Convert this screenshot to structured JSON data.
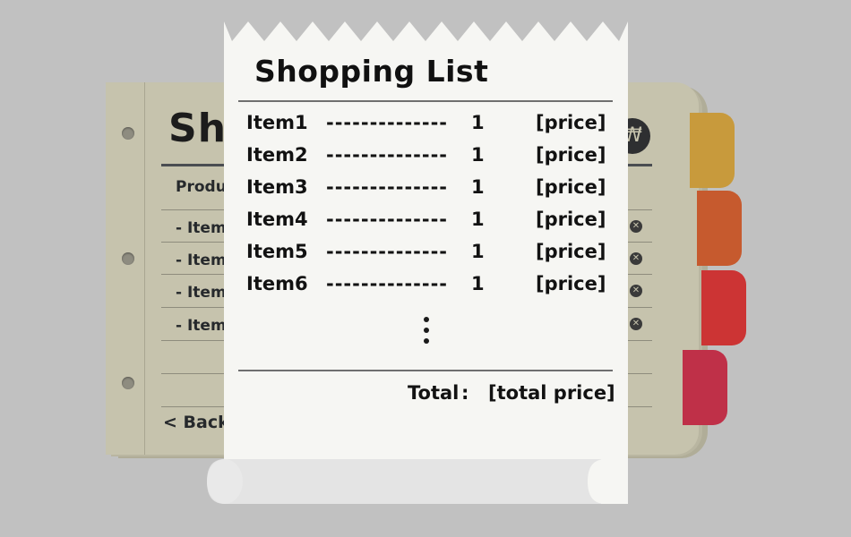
{
  "notebook": {
    "title": "Sh",
    "column_header": "Produ",
    "items": [
      "- Item",
      "- Item",
      "- Item",
      "- Item"
    ],
    "remove_icon": "x-circle-icon",
    "currency_icon": "won-icon",
    "currency_glyph": "₩",
    "back_label": "< Back"
  },
  "tabs": {
    "colors": [
      "#c89a3c",
      "#c65a2e",
      "#cc3434",
      "#bf3048"
    ]
  },
  "receipt": {
    "title": "Shopping List",
    "rows": [
      {
        "name": "Item1",
        "dashes": "--------------",
        "qty": "1",
        "price": "[price]"
      },
      {
        "name": "Item2",
        "dashes": "--------------",
        "qty": "1",
        "price": "[price]"
      },
      {
        "name": "Item3",
        "dashes": "--------------",
        "qty": "1",
        "price": "[price]"
      },
      {
        "name": "Item4",
        "dashes": "--------------",
        "qty": "1",
        "price": "[price]"
      },
      {
        "name": "Item5",
        "dashes": "--------------",
        "qty": "1",
        "price": "[price]"
      },
      {
        "name": "Item6",
        "dashes": "--------------",
        "qty": "1",
        "price": "[price]"
      }
    ],
    "more_icon": "vertical-ellipsis-icon",
    "total_label": "Total",
    "total_colon": ":",
    "total_value": "[total price]"
  }
}
